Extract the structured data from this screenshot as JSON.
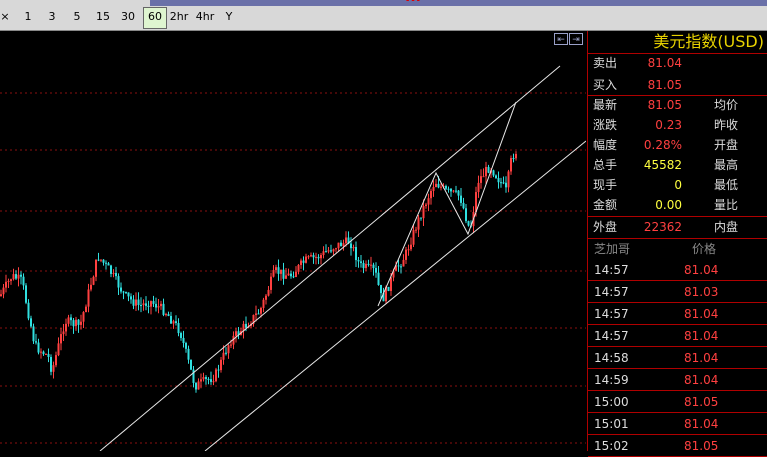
{
  "header": {
    "title_fragment": "...",
    "timeframes": [
      {
        "label": "×"
      },
      {
        "label": "1"
      },
      {
        "label": "3"
      },
      {
        "label": "5"
      },
      {
        "label": "15"
      },
      {
        "label": "30"
      },
      {
        "label": "60"
      },
      {
        "label": "2hr"
      },
      {
        "label": "4hr"
      },
      {
        "label": "Y"
      }
    ],
    "active_timeframe": "60"
  },
  "panel": {
    "title": "美元指数(USD)",
    "quote": {
      "sell_label": "卖出",
      "sell_value": "81.04",
      "buy_label": "买入",
      "buy_value": "81.05",
      "last_label": "最新",
      "last_value": "81.05",
      "avg_label": "均价",
      "change_label": "涨跌",
      "change_value": "0.23",
      "prev_close_label": "昨收",
      "pct_label": "幅度",
      "pct_value": "0.28%",
      "open_label": "开盘",
      "volume_label": "总手",
      "volume_value": "45582",
      "high_label": "最高",
      "cur_label": "现手",
      "cur_value": "0",
      "low_label": "最低",
      "amount_label": "金额",
      "amount_value": "0.00",
      "ratio_label": "量比",
      "outer_label": "外盘",
      "outer_value": "22362",
      "inner_label": "内盘"
    },
    "ticks_header": {
      "source": "芝加哥",
      "price": "价格"
    },
    "ticks": [
      {
        "time": "14:57",
        "price": "81.04"
      },
      {
        "time": "14:57",
        "price": "81.03"
      },
      {
        "time": "14:57",
        "price": "81.04"
      },
      {
        "time": "14:57",
        "price": "81.04"
      },
      {
        "time": "14:58",
        "price": "81.04"
      },
      {
        "time": "14:59",
        "price": "81.04"
      },
      {
        "time": "15:00",
        "price": "81.05"
      },
      {
        "time": "15:01",
        "price": "81.04"
      },
      {
        "time": "15:02",
        "price": "81.05"
      }
    ]
  },
  "colors": {
    "up": "#ff4040",
    "down": "#30e0e0",
    "accent": "#e8d200"
  }
}
